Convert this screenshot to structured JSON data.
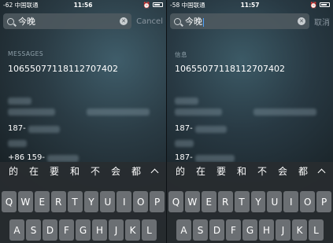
{
  "left": {
    "status": {
      "carrier": "-62 中国联通",
      "time": "11:56"
    },
    "search": {
      "query": "今晚",
      "cancel": "Cancel"
    },
    "section_title": "MESSAGES",
    "top_result": "10655077118112707402",
    "contacts": [
      "187-",
      "+86 159-"
    ]
  },
  "right": {
    "status": {
      "carrier": "-58 中国联通",
      "time": "11:57"
    },
    "search": {
      "query": "今晚",
      "cancel": "取消"
    },
    "section_title": "信息",
    "top_result": "10655077118112707402",
    "contacts": [
      "187-",
      "187-"
    ]
  },
  "keyboard": {
    "candidates": [
      "的",
      "在",
      "要",
      "和",
      "不",
      "会",
      "都"
    ],
    "row1": [
      "Q",
      "W",
      "E",
      "R",
      "T",
      "Y",
      "U",
      "I",
      "O",
      "P"
    ],
    "row2": [
      "A",
      "S",
      "D",
      "F",
      "G",
      "H",
      "J",
      "K",
      "L"
    ]
  },
  "colors": {
    "accent_caret": "#4da3ff"
  }
}
